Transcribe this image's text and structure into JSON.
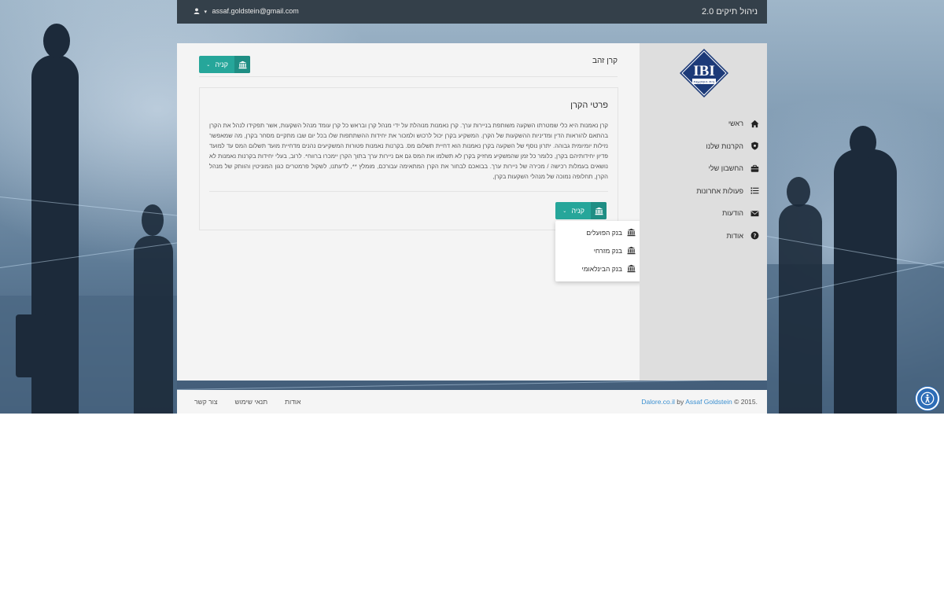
{
  "topbar": {
    "app_title": "ניהול תיקים 2.0",
    "user_email": "assaf.goldstein@gmail.com",
    "user_icon": "user-icon",
    "caret": "▾"
  },
  "sidebar": {
    "logo_text": "IBI",
    "logo_subtext": "בית השקעות",
    "items": [
      {
        "label": "ראשי",
        "icon": "home-icon"
      },
      {
        "label": "הקרנות שלנו",
        "icon": "shield-icon"
      },
      {
        "label": "החשבון שלי",
        "icon": "briefcase-icon"
      },
      {
        "label": "פעולות אחרונות",
        "icon": "list-icon"
      },
      {
        "label": "הודעות",
        "icon": "envelope-icon"
      },
      {
        "label": "אודות",
        "icon": "question-icon"
      }
    ]
  },
  "main": {
    "page_title": "קרן זהב",
    "buy_label": "קניה",
    "chevron": "⌄",
    "card": {
      "title": "פרטי הקרן",
      "body": "קרן נאמנות היא כלי שמטרתו השקעה משותפת בניירות ערך. קרן נאמנות מנוהלת על ידי מנהל קרן ובראש כל קרן עומד מנהל השקעות, אשר תפקידו לנהל את הקרן בהתאם להוראות הדין ומדיניות ההשקעות של הקרן. המשקיע בקרן יכול לרכוש ולמכור את יחידות ההשתתפות שלו בכל יום שבו מתקיים מסחר בקרן, מה שמאפשר נזילות יומיומית גבוהה. יתרון נוסף של השקעה בקרן נאמנות הוא דחיית תשלום מס. בקרנות נאמנות פטורות המשקיעים נהנים מדחיית מועד תשלום המס עד למועד פדיון יחידותיהם בקרן, כלומר כל זמן שהמשקיע מחזיק בקרן לא תשלמו את המס גם אם ניירות ערך בתוך הקרן יימכרו ברווח*. לרוב, בעלי יחידות בקרנות נאמנות לא נושאים בעמלות רכישה / מכירה של ניירות ערך. בבואכם לבחור את הקרן המתאימה עבורכם, מומלץ **, לדעתנו, לשקול פרמטרים כגון המוניטין והוותק של מנהל הקרן, תחלופה נמוכה של מנהלי השקעות בקרן,"
    },
    "dropdown": [
      {
        "label": "בנק הפועלים",
        "icon": "bank-icon"
      },
      {
        "label": "בנק מזרחי",
        "icon": "bank-icon"
      },
      {
        "label": "בנק הבינלאומי",
        "icon": "bank-icon"
      }
    ]
  },
  "footer": {
    "copyright_prefix": "© 2015.",
    "author": "Assaf Goldstein",
    "by": "by",
    "site": "Dalore.co.il",
    "links": [
      "אודות",
      "תנאי שימוש",
      "צור קשר"
    ]
  },
  "accessibility_icon": "accessibility-icon",
  "colors": {
    "accent": "#26a69a",
    "topbar": "#34404a",
    "sidebar": "#dedede",
    "link": "#3a8fd0",
    "logo_blue": "#1c3a78"
  }
}
